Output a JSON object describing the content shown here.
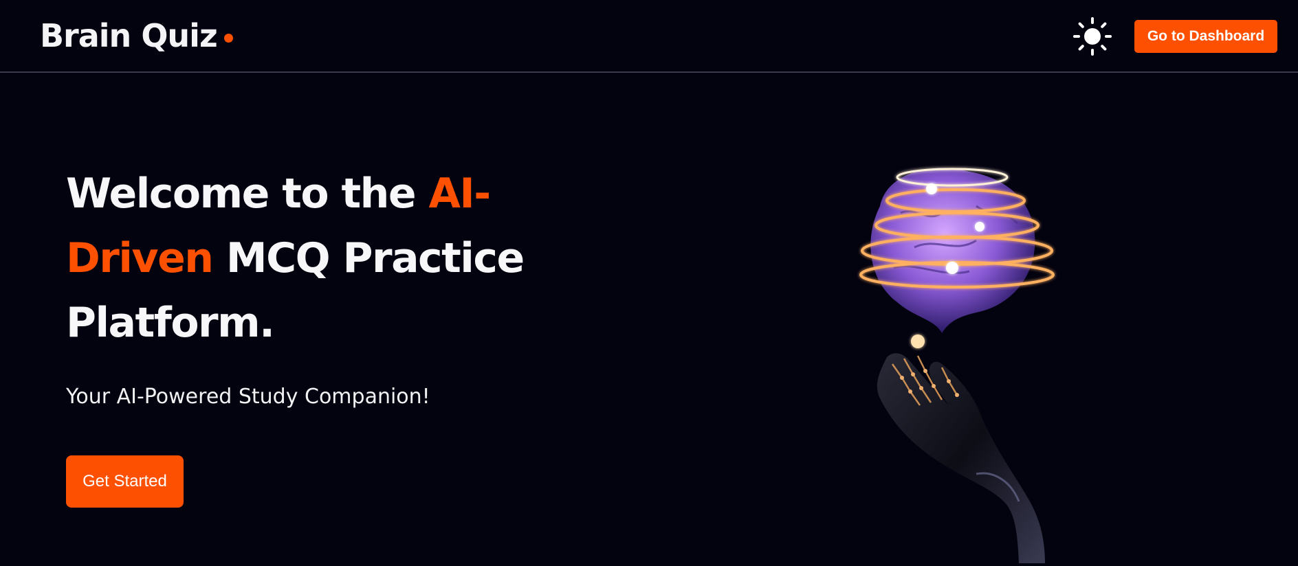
{
  "header": {
    "brand": "Brain Quiz",
    "theme_toggle_icon": "sun-icon",
    "dashboard_button": "Go to Dashboard"
  },
  "hero": {
    "title_part1": "Welcome to the ",
    "title_accent_line1": "AI-",
    "title_accent_line2": "Driven",
    "title_part2": " MCQ Practice",
    "title_part3": "Platform.",
    "subtitle": "Your AI-Powered Study Companion!",
    "cta_button": "Get Started",
    "illustration_icon": "robot-hand-brain-icon"
  },
  "colors": {
    "background": "#03020f",
    "accent": "#fe5001",
    "text": "#f7f7f9",
    "divider": "#3a3a4a"
  }
}
